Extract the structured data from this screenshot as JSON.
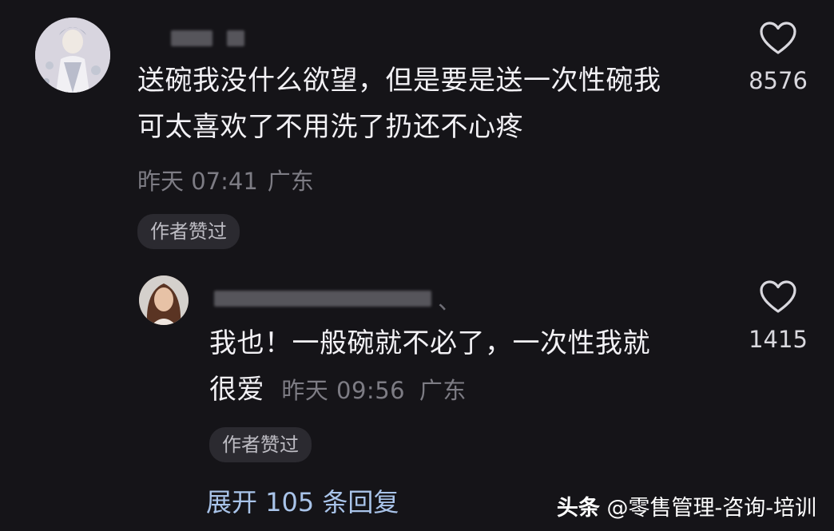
{
  "comments": [
    {
      "avatar_icon": "illustrated-avatar",
      "text_lines": [
        "送碗我没什么欲望，但是要是送一次性碗我",
        "可太喜欢了不用洗了扔还不心疼"
      ],
      "time": "昨天 07:41",
      "location": "广东",
      "badge": "作者赞过",
      "likes": "8576"
    },
    {
      "avatar_icon": "photo-avatar",
      "text_lines": [
        "我也！一般碗就不必了，一次性我就",
        "很爱"
      ],
      "time": "昨天 09:56",
      "location": "广东",
      "badge": "作者赞过",
      "likes": "1415",
      "name_suffix": "、"
    }
  ],
  "expand_replies": "展开 105 条回复",
  "watermark": {
    "brand": "头条",
    "account": "@零售管理-咨询-培训"
  },
  "colors": {
    "background": "#151418",
    "text": "#f2f1f5",
    "meta": "#7d7c84",
    "link": "#a9c4ea",
    "badge_bg": "#2b2a30"
  }
}
